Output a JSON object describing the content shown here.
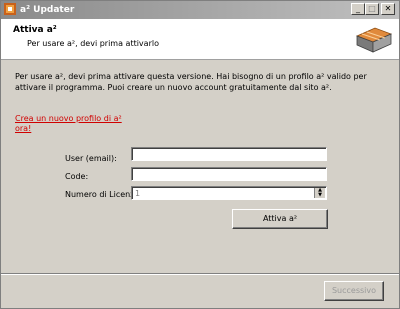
{
  "window": {
    "title": "a² Updater",
    "controls": {
      "minimize": "_",
      "maximize": "□",
      "close": "✕"
    }
  },
  "header": {
    "title": "Attiva a²",
    "subtitle": "Per usare a², devi prima attivarlo"
  },
  "content": {
    "intro": "Per usare a², devi prima attivare questa versione. Hai bisogno di un profilo a² valido per attivare il programma. Puoi creare un nuovo account gratuitamente dal sito a².",
    "create_profile_link": "Crea un nuovo profilo di a² ora!"
  },
  "form": {
    "user_label": "User (email):",
    "user_value": "",
    "code_label": "Code:",
    "code_value": "",
    "license_label": "Numero di Licenze:",
    "license_value": "1",
    "activate_button": "Attiva a²"
  },
  "footer": {
    "next_button": "Successivo"
  },
  "colors": {
    "link": "#d00000",
    "titlebar_inactive": "#8a8a8a",
    "window_bg": "#d4d0c8"
  }
}
